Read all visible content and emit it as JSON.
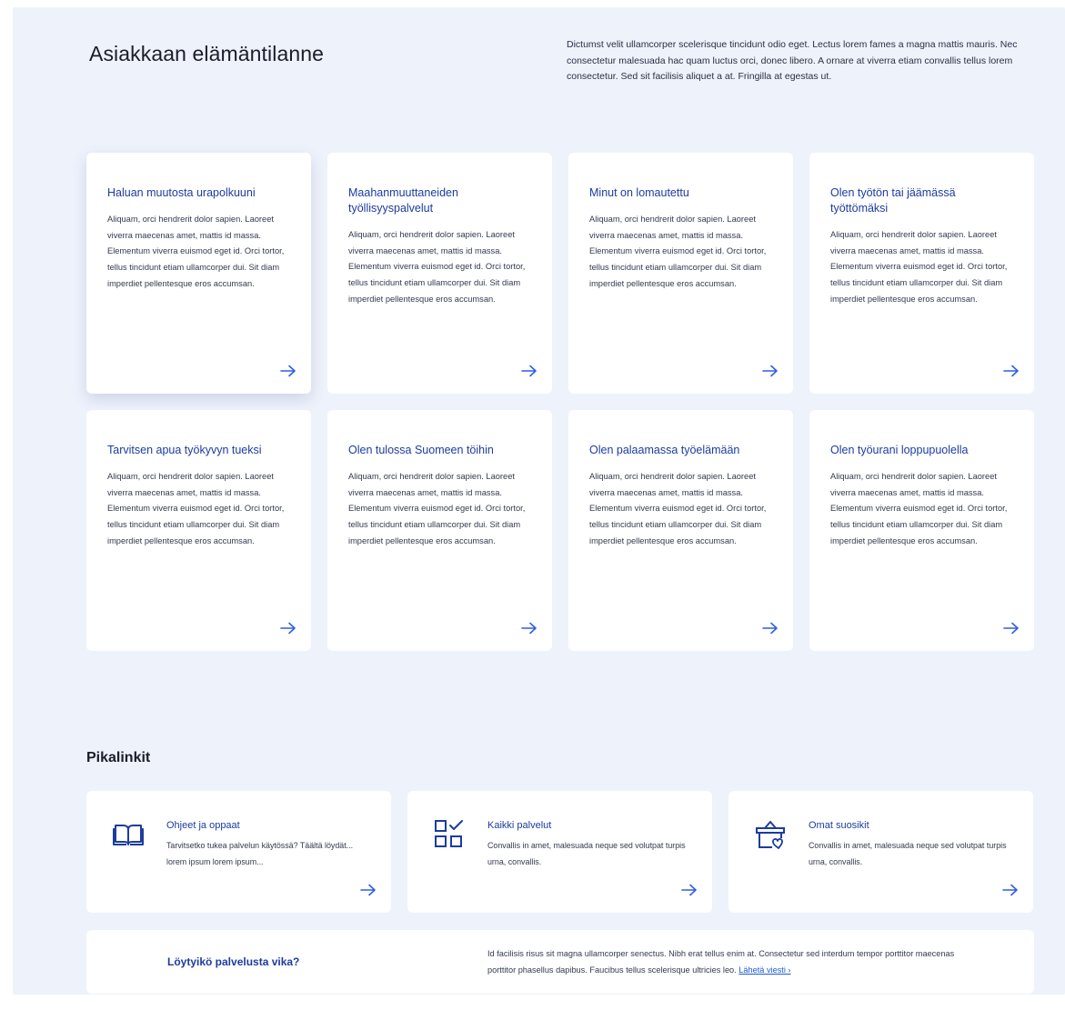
{
  "hero": {
    "title": "Asiakkaan elämäntilanne",
    "description": "Dictumst velit ullamcorper scelerisque tincidunt odio eget. Lectus lorem fames a magna mattis mauris. Nec consectetur malesuada hac quam luctus orci, donec libero. A ornare at viverra etiam convallis tellus lorem consectetur. Sed sit facilisis aliquet a at. Fringilla at egestas ut."
  },
  "cards": [
    {
      "title": "Haluan muutosta urapolkuuni",
      "text": "Aliquam, orci hendrerit dolor sapien. Laoreet viverra maecenas amet, mattis id massa. Elementum viverra euismod eget id. Orci tortor, tellus tincidunt etiam ullamcorper dui. Sit diam imperdiet pellentesque eros accumsan.",
      "icon": "arrow-right-icon"
    },
    {
      "title": "Maahanmuuttaneiden työllisyyspalvelut",
      "text": "Aliquam, orci hendrerit dolor sapien. Laoreet viverra maecenas amet, mattis id massa. Elementum viverra euismod eget id. Orci tortor, tellus tincidunt etiam ullamcorper dui. Sit diam imperdiet pellentesque eros accumsan.",
      "icon": "arrow-right-icon"
    },
    {
      "title": "Minut on lomautettu",
      "text": "Aliquam, orci hendrerit dolor sapien. Laoreet viverra maecenas amet, mattis id massa. Elementum viverra euismod eget id. Orci tortor, tellus tincidunt etiam ullamcorper dui. Sit diam imperdiet pellentesque eros accumsan.",
      "icon": "arrow-right-icon"
    },
    {
      "title": "Olen työtön tai jäämässä työttömäksi",
      "text": "Aliquam, orci hendrerit dolor sapien. Laoreet viverra maecenas amet, mattis id massa. Elementum viverra euismod eget id. Orci tortor, tellus tincidunt etiam ullamcorper dui. Sit diam imperdiet pellentesque eros accumsan.",
      "icon": "arrow-right-icon"
    },
    {
      "title": "Tarvitsen apua työkyvyn tueksi",
      "text": "Aliquam, orci hendrerit dolor sapien. Laoreet viverra maecenas amet, mattis id massa. Elementum viverra euismod eget id. Orci tortor, tellus tincidunt etiam ullamcorper dui. Sit diam imperdiet pellentesque eros accumsan.",
      "icon": "arrow-right-icon"
    },
    {
      "title": "Olen tulossa Suomeen töihin",
      "text": "Aliquam, orci hendrerit dolor sapien. Laoreet viverra maecenas amet, mattis id massa. Elementum viverra euismod eget id. Orci tortor, tellus tincidunt etiam ullamcorper dui. Sit diam imperdiet pellentesque eros accumsan.",
      "icon": "arrow-right-icon"
    },
    {
      "title": "Olen palaamassa työelämään",
      "text": "Aliquam, orci hendrerit dolor sapien. Laoreet viverra maecenas amet, mattis id massa. Elementum viverra euismod eget id. Orci tortor, tellus tincidunt etiam ullamcorper dui. Sit diam imperdiet pellentesque eros accumsan.",
      "icon": "arrow-right-icon"
    },
    {
      "title": "Olen työurani loppupuolella",
      "text": "Aliquam, orci hendrerit dolor sapien. Laoreet viverra maecenas amet, mattis id massa. Elementum viverra euismod eget id. Orci tortor, tellus tincidunt etiam ullamcorper dui. Sit diam imperdiet pellentesque eros accumsan.",
      "icon": "arrow-right-icon"
    }
  ],
  "quick_links": {
    "title": "Pikalinkit",
    "items": [
      {
        "icon": "book-icon",
        "title": "Ohjeet ja oppaat",
        "text": "Tarvitsetko tukea palvelun käytössä? Täältä löydät... lorem ipsum lorem ipsum..."
      },
      {
        "icon": "services-grid-icon",
        "title": "Kaikki palvelut",
        "text": "Convallis in amet, malesuada neque sed volutpat turpis urna, convallis."
      },
      {
        "icon": "favorites-basket-icon",
        "title": "Omat suosikit",
        "text": "Convallis in amet, malesuada neque sed volutpat turpis urna, convallis."
      }
    ]
  },
  "feedback": {
    "title": "Löytyikö palvelusta vika?",
    "text": "Id facilisis risus sit magna ullamcorper senectus. Nibh erat tellus enim at. Consectetur sed interdum tempor porttitor maecenas porttitor phasellus dapibus. Faucibus tellus scelerisque ultricies leo.",
    "link": "Lähetä viesti ›"
  },
  "colors": {
    "accent": "#1c3c9e",
    "link": "#1c5bd6",
    "background": "#eef2fb",
    "card": "#ffffff"
  }
}
